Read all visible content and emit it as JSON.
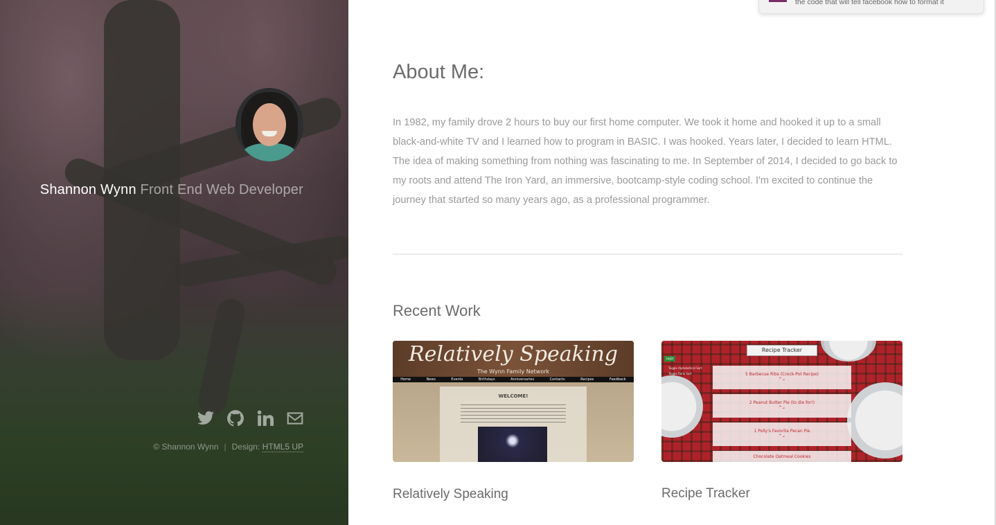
{
  "hero": {
    "name": "Shannon Wynn",
    "tagline": "Front End Web Developer",
    "copyright": "© Shannon Wynn",
    "design_label": "Design:",
    "design_link": "HTML5 UP",
    "social": [
      "twitter-icon",
      "github-icon",
      "linkedin-icon",
      "email-icon"
    ]
  },
  "about": {
    "title": "About Me:",
    "text": "In 1982, my family drove 2 hours to buy our first home computer. We took it home and hooked it up to a small black-and-white TV and I learned how to program in BASIC. I was hooked. Years later, I decided to learn HTML. The idea of making something from nothing was fascinating to me. In September of 2014, I decided to go back to my roots and attend The Iron Yard, an immersive, bootcamp-style coding school. I'm excited to continue the journey that started so many years ago, as a professional programmer."
  },
  "recent_work": {
    "title": "Recent Work",
    "items": [
      {
        "title": "Relatively Speaking",
        "thumb": {
          "script": "Relatively Speaking",
          "sub": "The Wynn Family Network",
          "nav": [
            "Home",
            "News",
            "Events",
            "Birthdays",
            "Anniversaries",
            "Contacts",
            "Recipes",
            "Feedback"
          ],
          "welcome": "WELCOME!"
        }
      },
      {
        "title": "Recipe Tracker",
        "thumb": {
          "header": "Recipe Tracker",
          "login": "Login",
          "toggle1": "Toggle Alphabetical Sort",
          "toggle2": "Toggle Rank Sort",
          "cards": [
            "5 Barbecue Ribs (Crock-Pot Recipe)",
            "2 Peanut Butter Pie (to die for!)",
            "1 Polly's Favorite Pecan Pie",
            "Chocolate Oatmeal Cookies"
          ]
        }
      }
    ]
  },
  "popup": {
    "message": "the code that will tell facebook how to format it"
  },
  "colors": {
    "heading": "#6b6b6b",
    "body_text": "#9a9a9a",
    "accent_popup": "#7a2d68"
  }
}
